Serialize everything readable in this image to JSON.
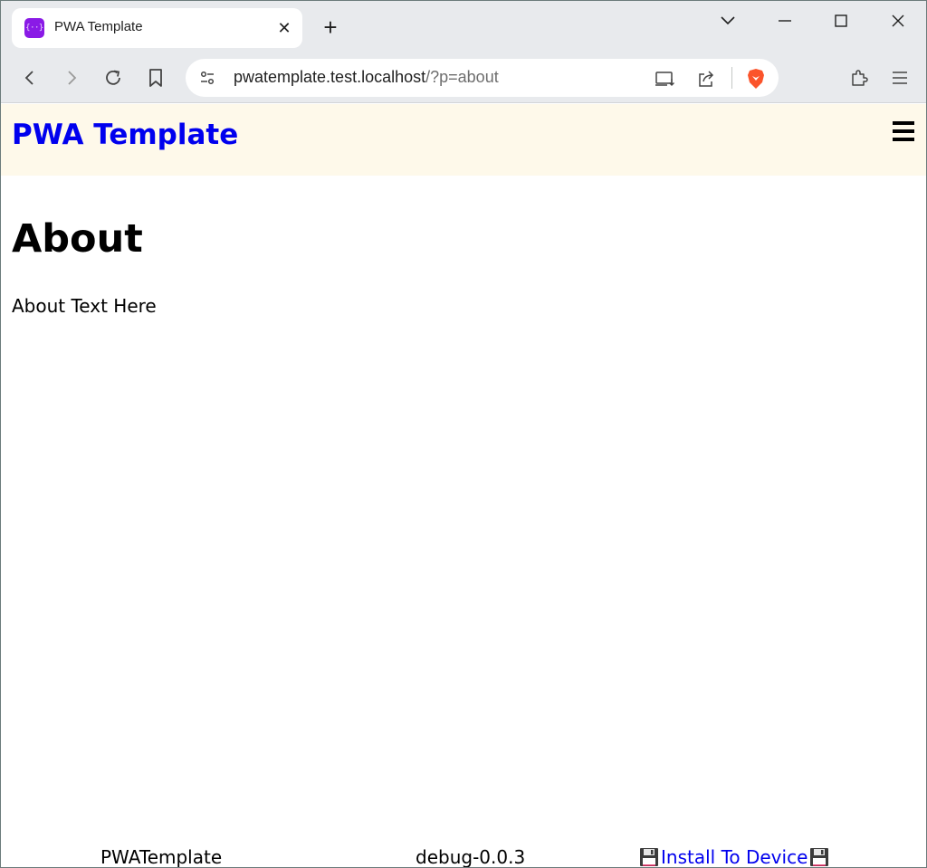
{
  "browser": {
    "tab": {
      "title": "PWA Template",
      "favicon_text": "{··}",
      "close_glyph": "✕"
    },
    "new_tab_glyph": "+",
    "url": {
      "host": "pwatemplate.test.localhost",
      "path": "/?p=about"
    },
    "icons": {
      "back": "back-arrow-icon",
      "forward": "forward-arrow-icon",
      "reload": "reload-icon",
      "bookmark": "bookmark-icon",
      "site_settings": "site-settings-icon",
      "install_app": "install-app-icon",
      "share": "share-icon",
      "brave": "brave-shield-icon",
      "extensions": "extensions-icon",
      "menu": "menu-icon"
    },
    "colors": {
      "chrome_bg": "#e8eaed",
      "favicon": "#8a1ae6",
      "brave": "#fb542b"
    }
  },
  "site": {
    "title": "PWA Template",
    "header_bg": "#fef9ea",
    "link_color": "#0000ee",
    "menu_icon": "hamburger-icon"
  },
  "main": {
    "heading": "About",
    "text": "About Text Here"
  },
  "footer": {
    "app_name": "PWATemplate",
    "version": "debug-0.0.3",
    "install_label": "Install To Device",
    "install_icon": "floppy-disk-icon"
  }
}
